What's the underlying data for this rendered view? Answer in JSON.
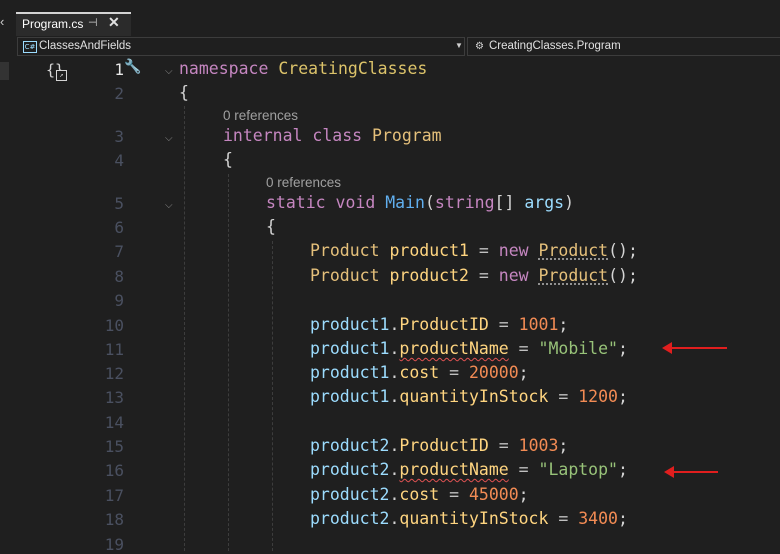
{
  "tab": {
    "left_glyph": "‹",
    "title": "Program.cs",
    "pin": "⊣",
    "close": "✕"
  },
  "nav": {
    "left_badge": "C#",
    "left_text": "ClassesAndFields",
    "caret": "▼",
    "right_icon": "⚙",
    "right_text": "CreatingClasses.Program"
  },
  "editor": {
    "line_numbers": [
      "1",
      "2",
      "3",
      "4",
      "5",
      "6",
      "7",
      "8",
      "9",
      "10",
      "11",
      "12",
      "13",
      "14",
      "15",
      "16",
      "17",
      "18",
      "19"
    ],
    "active_line": 1,
    "lens_class": "0 references",
    "lens_main": "0 references",
    "fold_glyph": "⌵"
  },
  "code": {
    "ns_kw": "namespace",
    "ns_name": "CreatingClasses",
    "brace_open": "{",
    "brace_close": "}",
    "internal": "internal",
    "class_kw": "class",
    "class_name": "Program",
    "static": "static",
    "void": "void",
    "main": "Main",
    "paren_open": "(",
    "string_type": "string",
    "arr": "[]",
    "args": "args",
    "paren_close": ")",
    "product_type": "Product",
    "p1": "product1",
    "p2": "product2",
    "new_kw": "new",
    "ctor_tail": "();",
    "eq": "=",
    "dot": ".",
    "semi": ";",
    "f_id": "ProductID",
    "f_name": "productName",
    "f_cost": "cost",
    "f_qty": "quantityInStock",
    "v1_id": "1001",
    "v1_name": "\"Mobile\"",
    "v1_cost": "20000",
    "v1_qty": "1200",
    "v2_id": "1003",
    "v2_name": "\"Laptop\"",
    "v2_cost": "45000",
    "v2_qty": "3400"
  },
  "colors": {
    "arrow": "#e01e1e"
  }
}
